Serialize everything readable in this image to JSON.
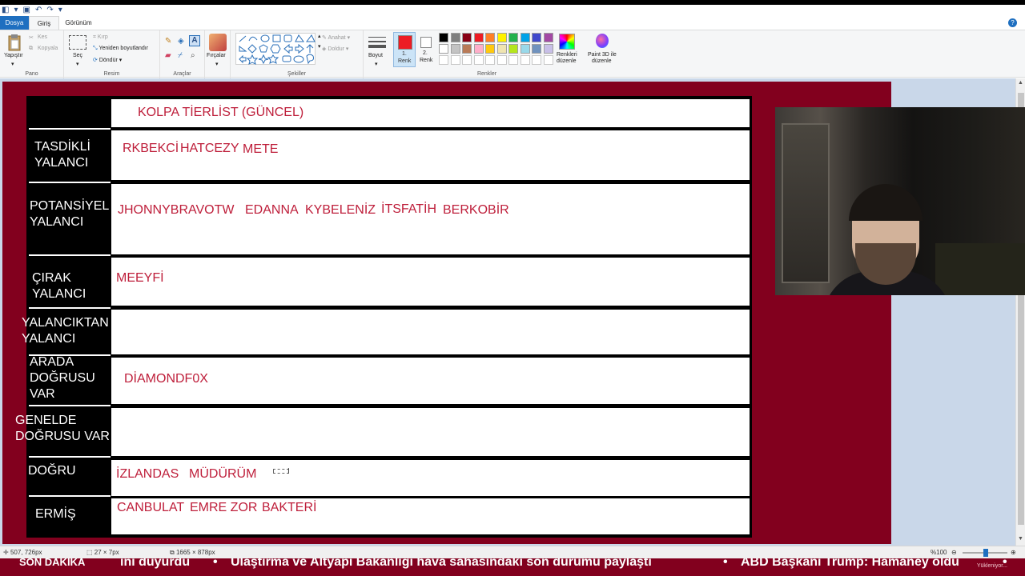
{
  "tabs": {
    "file": "Dosya",
    "home": "Giriş",
    "view": "Görünüm"
  },
  "ribbon": {
    "clipboard": {
      "paste": "Yapıştır",
      "cut": "Kes",
      "copy": "Kopyala",
      "label": "Pano"
    },
    "image": {
      "select": "Seç",
      "crop": "Kırp",
      "resize": "Yeniden boyutlandır",
      "rotate": "Döndür",
      "label": "Resim"
    },
    "tools": {
      "label": "Araçlar"
    },
    "brushes": {
      "label": "Fırçalar"
    },
    "shapes": {
      "outline": "Anahat",
      "fill": "Doldur",
      "label": "Şekiller"
    },
    "size": {
      "label": "Boyut"
    },
    "colors": {
      "color1": "1.\nRenk",
      "color1_a": "1.",
      "color1_b": "Renk",
      "color2_a": "2.",
      "color2_b": "Renk",
      "edit": "Renkleri düzenle",
      "edit_a": "Renkleri",
      "edit_b": "düzenle",
      "paint3d_a": "Paint 3D ile",
      "paint3d_b": "düzenle",
      "label": "Renkler",
      "palette_row1": [
        "#000000",
        "#7f7f7f",
        "#880015",
        "#ed1c24",
        "#ff7f27",
        "#fff200",
        "#22b14c",
        "#00a2e8",
        "#3f48cc",
        "#a349a4"
      ],
      "palette_row2": [
        "#ffffff",
        "#c3c3c3",
        "#b97a57",
        "#ffaec9",
        "#ffc90e",
        "#efe4b0",
        "#b5e61d",
        "#99d9ea",
        "#7092be",
        "#c8bfe7"
      ]
    }
  },
  "board": {
    "title": "KOLPA TİERLİST (GÜNCEL)",
    "rows": [
      {
        "label_lines": [
          "TASDİKLİ",
          "YALANCI"
        ],
        "names": [
          "RKBEKCİ",
          "HATCEZY",
          "METE"
        ]
      },
      {
        "label_lines": [
          "POTANSİYEL",
          "YALANCI"
        ],
        "names": [
          "JHONNYBRAVOTW",
          "EDANNA",
          "KYBELENİZ",
          "İTSFATİH",
          "BERKOBİR"
        ]
      },
      {
        "label_lines": [
          "ÇIRAK",
          "YALANCI"
        ],
        "names": [
          "MEEYFİ"
        ]
      },
      {
        "label_lines": [
          "YALANCIKTAN",
          "YALANCI"
        ],
        "names": []
      },
      {
        "label_lines": [
          "ARADA",
          "DOĞRUSU",
          "VAR"
        ],
        "names": [
          "DİAMONDF0X"
        ]
      },
      {
        "label_lines": [
          "GENELDE",
          "DOĞRUSU VAR"
        ],
        "names": []
      },
      {
        "label_lines": [
          "DOĞRU"
        ],
        "names": [
          "İZLANDAS",
          "MÜDÜRÜM"
        ]
      },
      {
        "label_lines": [
          "ERMİŞ"
        ],
        "names": [
          "CANBULAT",
          "EMRE ZOR",
          "BAKTERİ"
        ]
      }
    ]
  },
  "status": {
    "cursor": "507, 726px",
    "selection": "27 × 7px",
    "image_size": "1665 × 878px",
    "zoom": "%100"
  },
  "ticker": {
    "tag": "SON DAKİKA",
    "items": [
      "ini duyurdu",
      "Ulaştırma ve Altyapı Bakanlığı hava sahasındaki son durumu paylaştı",
      "ABD Başkanı Trump: Hamaney öldü"
    ],
    "separator": "•",
    "loading": "Yükleniyor..."
  }
}
